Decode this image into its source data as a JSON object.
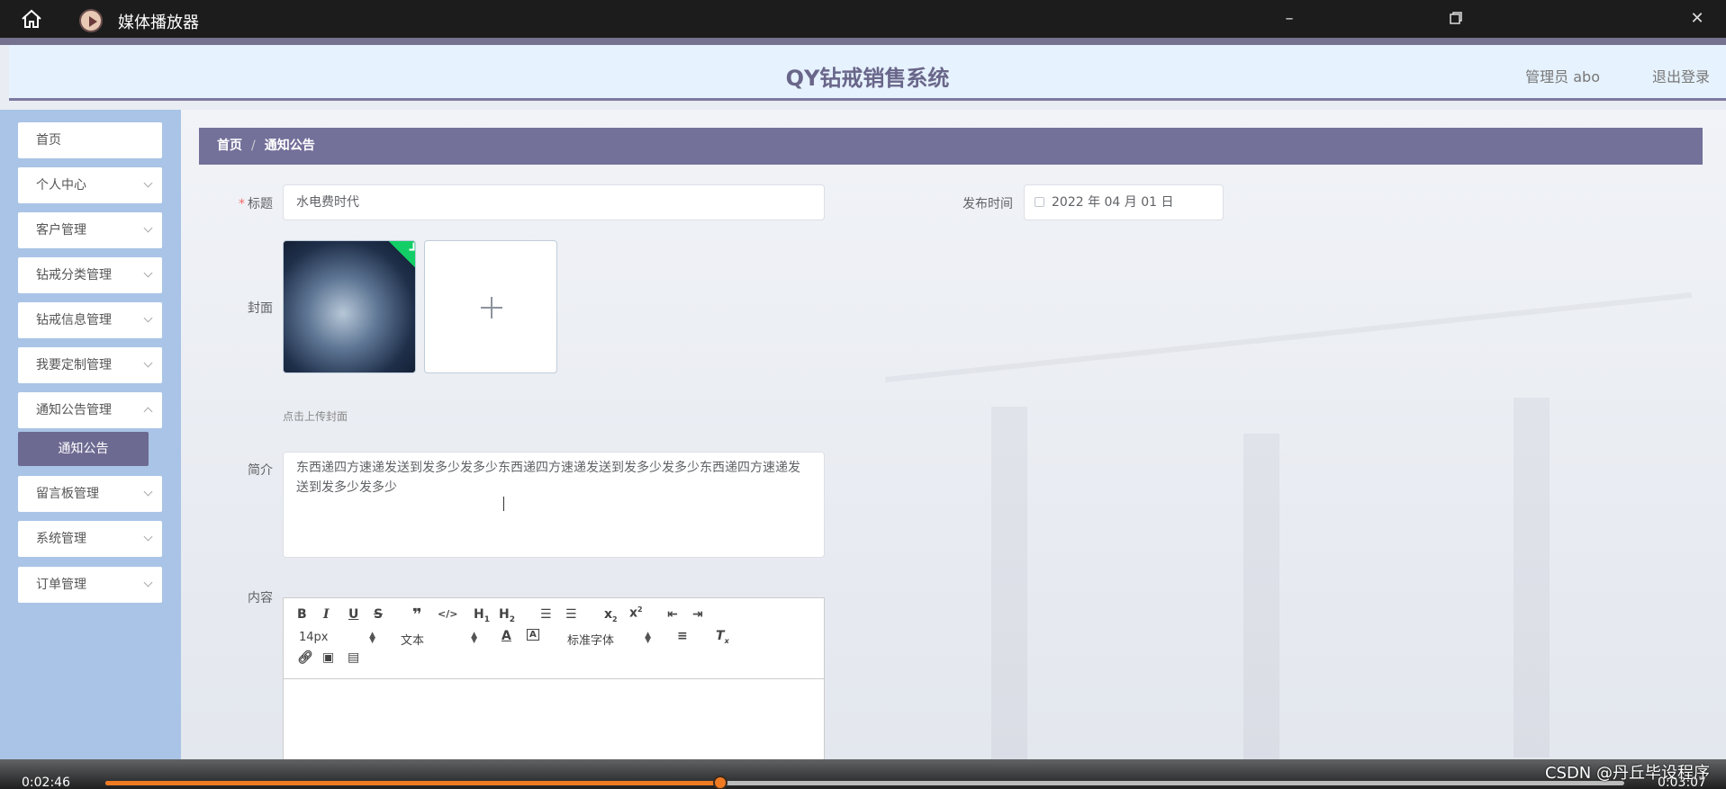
{
  "window": {
    "title": "媒体播放器"
  },
  "header": {
    "title": "QY钻戒销售系统",
    "user": "管理员 abo",
    "logout": "退出登录"
  },
  "sidebar": {
    "items": [
      {
        "label": "首页",
        "chevron": false
      },
      {
        "label": "个人中心",
        "chevron": true
      },
      {
        "label": "客户管理",
        "chevron": true
      },
      {
        "label": "钻戒分类管理",
        "chevron": true
      },
      {
        "label": "钻戒信息管理",
        "chevron": true
      },
      {
        "label": "我要定制管理",
        "chevron": true
      },
      {
        "label": "通知公告管理",
        "chevron": true
      },
      {
        "label": "留言板管理",
        "chevron": true
      },
      {
        "label": "系统管理",
        "chevron": true
      },
      {
        "label": "订单管理",
        "chevron": true
      }
    ],
    "active_sub": "通知公告"
  },
  "breadcrumb": {
    "home": "首页",
    "sep": "/",
    "current": "通知公告"
  },
  "form": {
    "title_label": "标题",
    "title_value": "水电费时代",
    "publish_label": "发布时间",
    "publish_value": "2022 年 04 月 01 日",
    "cover_label": "封面",
    "cover_hint": "点击上传封面",
    "intro_label": "简介",
    "intro_value": "东西递四方速递发送到发多少发多少东西递四方速递发送到发多少发多少东西递四方速递发送到发多少发多少",
    "content_label": "内容"
  },
  "editor": {
    "font_size": "14px",
    "text_type": "文本",
    "font_family": "标准字体"
  },
  "player": {
    "current_time": "0:02:46",
    "total_time": "0:03:07",
    "progress": 0.405
  },
  "watermark": "CSDN @丹丘毕设程序",
  "colors": {
    "accent": "#73709a",
    "player_progress": "#f07a22",
    "success": "#13ce66"
  }
}
